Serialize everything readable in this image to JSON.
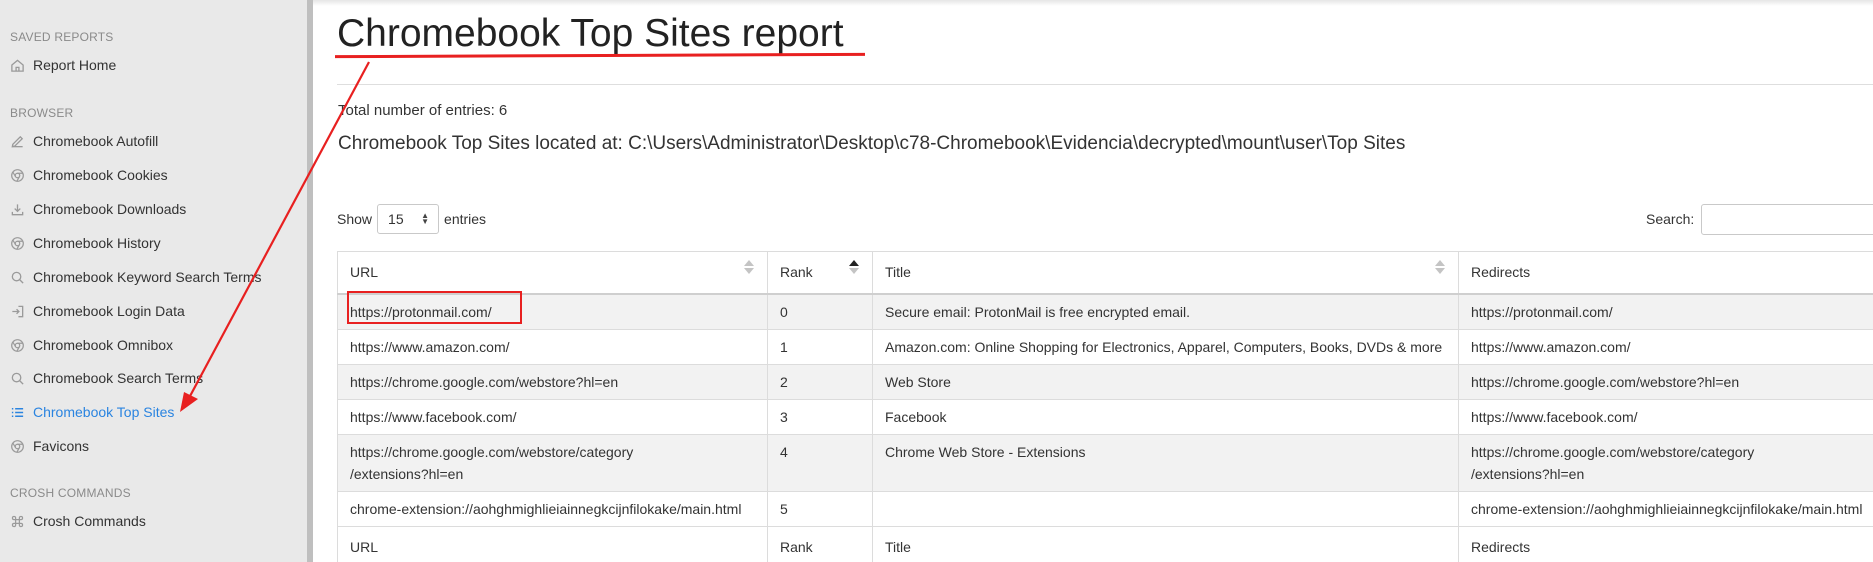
{
  "sidebar": {
    "sections": [
      {
        "title": "SAVED REPORTS"
      },
      {
        "title": "BROWSER"
      },
      {
        "title": "CROSH COMMANDS"
      }
    ],
    "items": [
      {
        "label": "Report Home",
        "icon": "home-icon"
      },
      {
        "label": "Chromebook Autofill",
        "icon": "pencil-icon"
      },
      {
        "label": "Chromebook Cookies",
        "icon": "chrome-icon"
      },
      {
        "label": "Chromebook Downloads",
        "icon": "download-icon"
      },
      {
        "label": "Chromebook History",
        "icon": "chrome-icon"
      },
      {
        "label": "Chromebook Keyword Search Terms",
        "icon": "search-icon"
      },
      {
        "label": "Chromebook Login Data",
        "icon": "login-icon"
      },
      {
        "label": "Chromebook Omnibox",
        "icon": "chrome-icon"
      },
      {
        "label": "Chromebook Search Terms",
        "icon": "search-icon"
      },
      {
        "label": "Chromebook Top Sites",
        "icon": "list-icon",
        "active": true
      },
      {
        "label": "Favicons",
        "icon": "chrome-icon"
      },
      {
        "label": "Crosh Commands",
        "icon": "command-icon"
      }
    ]
  },
  "main": {
    "title": "Chromebook Top Sites report",
    "total": "Total number of entries: 6",
    "located": "Chromebook Top Sites located at: C:\\Users\\Administrator\\Desktop\\c78-Chromebook\\Evidencia\\decrypted\\mount\\user\\Top Sites",
    "show_label": "Show",
    "entries_value": "15",
    "entries_label": "entries",
    "search_label": "Search:",
    "search_value": "",
    "columns": [
      "URL",
      "Rank",
      "Title",
      "Redirects"
    ],
    "rows": [
      {
        "url": "https://protonmail.com/",
        "rank": "0",
        "title": "Secure email: ProtonMail is free encrypted email.",
        "redirects": "https://protonmail.com/"
      },
      {
        "url": "https://www.amazon.com/",
        "rank": "1",
        "title": "Amazon.com: Online Shopping for Electronics, Apparel, Computers, Books, DVDs & more",
        "redirects": "https://www.amazon.com/"
      },
      {
        "url": "https://chrome.google.com/webstore?hl=en",
        "rank": "2",
        "title": "Web Store",
        "redirects": "https://chrome.google.com/webstore?hl=en"
      },
      {
        "url": "https://www.facebook.com/",
        "rank": "3",
        "title": "Facebook",
        "redirects": "https://www.facebook.com/"
      },
      {
        "url": "https://chrome.google.com/webstore/category\n/extensions?hl=en",
        "rank": "4",
        "title": "Chrome Web Store - Extensions",
        "redirects": "https://chrome.google.com/webstore/category\n/extensions?hl=en"
      },
      {
        "url": "chrome-extension://aohghmighlieiainnegkcijnfilokake/main.html",
        "rank": "5",
        "title": "",
        "redirects": "chrome-extension://aohghmighlieiainnegkcijnfilokake/main.html"
      }
    ]
  },
  "colors": {
    "accent": "#2a84e0",
    "annotation": "#e82020",
    "sidebar_bg": "#e9e9e9"
  }
}
